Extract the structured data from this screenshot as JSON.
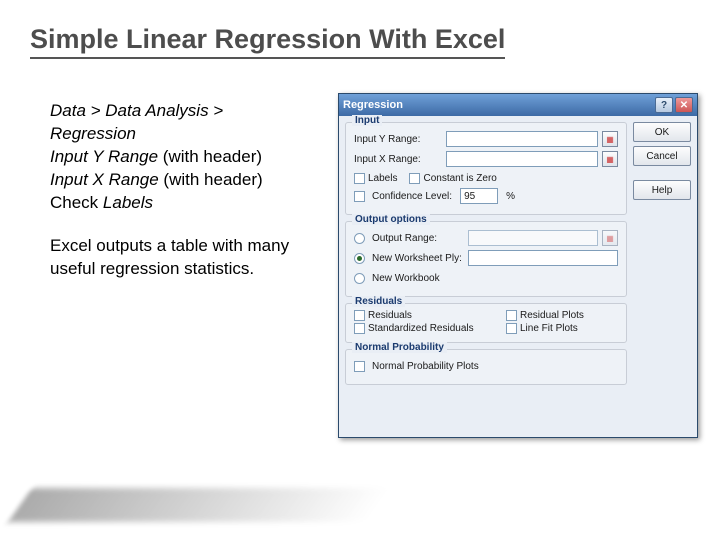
{
  "title": "Simple Linear Regression With Excel",
  "instructions": {
    "line1a": "Data > Data Analysis > Regression",
    "line2": "Input Y Range",
    "with_header1": " (with header)",
    "line3": "Input X Range",
    "with_header2": " (with header)",
    "line4a": "Check ",
    "line4b": "Labels",
    "para2": "Excel outputs a table with many useful regression statistics."
  },
  "dialog": {
    "title": "Regression",
    "buttons": {
      "ok": "OK",
      "cancel": "Cancel",
      "help": "Help"
    },
    "input": {
      "header": "Input",
      "y_label": "Input Y Range:",
      "x_label": "Input X Range:",
      "labels": "Labels",
      "const_zero": "Constant is Zero",
      "conf_level": "Confidence Level:",
      "conf_value": "95",
      "percent": "%"
    },
    "output": {
      "header": "Output options",
      "output_range": "Output Range:",
      "new_ws": "New Worksheet Ply:",
      "new_wb": "New Workbook"
    },
    "residuals": {
      "header": "Residuals",
      "residuals": "Residuals",
      "std_residuals": "Standardized Residuals",
      "resid_plots": "Residual Plots",
      "line_fit": "Line Fit Plots"
    },
    "normal": {
      "header": "Normal Probability",
      "plots": "Normal Probability Plots"
    }
  }
}
